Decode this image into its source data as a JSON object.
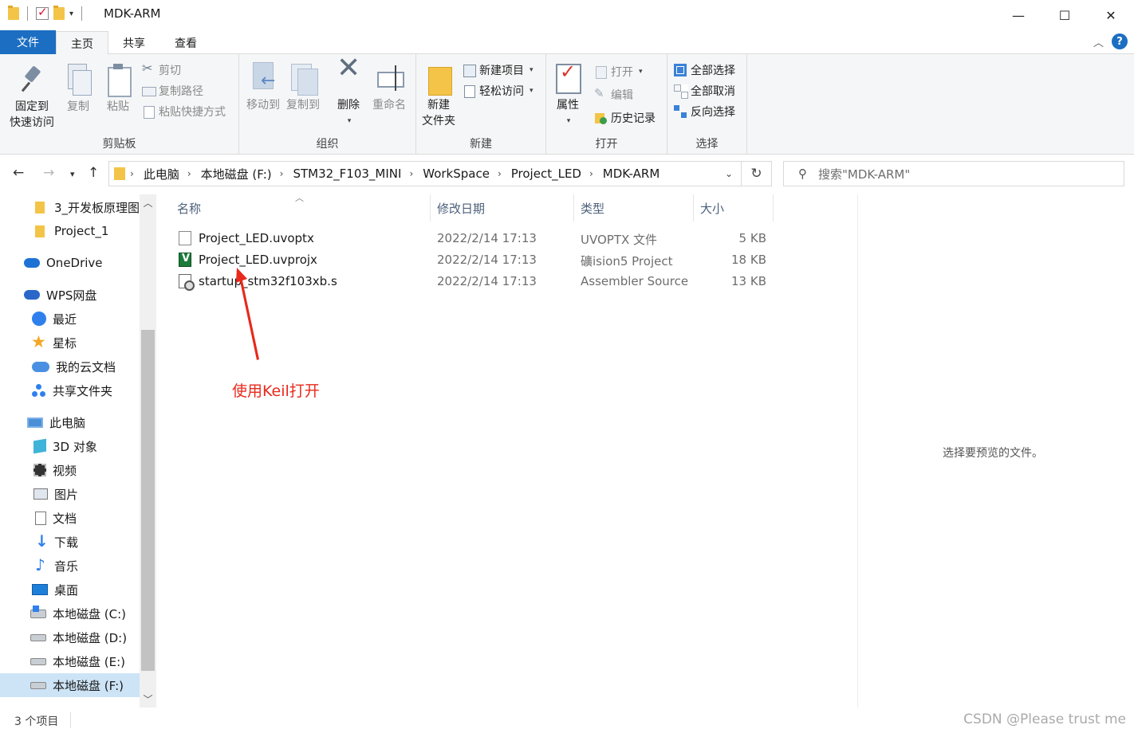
{
  "window": {
    "title": "MDK-ARM",
    "minimize": "—",
    "maximize": "☐",
    "close": "✕"
  },
  "ribbon_tabs": {
    "file": "文件",
    "home": "主页",
    "share": "共享",
    "view": "查看"
  },
  "ribbon": {
    "clipboard": {
      "label": "剪贴板",
      "pin": "固定到\n快速访问",
      "pin_line1": "固定到",
      "pin_line2": "快速访问",
      "copy": "复制",
      "paste": "粘贴",
      "cut": "剪切",
      "copy_path": "复制路径",
      "paste_shortcut": "粘贴快捷方式"
    },
    "organize": {
      "label": "组织",
      "move_to": "移动到",
      "copy_to": "复制到",
      "delete": "删除",
      "rename": "重命名"
    },
    "new": {
      "label": "新建",
      "new_folder_line1": "新建",
      "new_folder_line2": "文件夹",
      "new_item": "新建项目",
      "easy_access": "轻松访问"
    },
    "open": {
      "label": "打开",
      "properties": "属性",
      "open": "打开",
      "edit": "编辑",
      "history": "历史记录"
    },
    "select": {
      "label": "选择",
      "select_all": "全部选择",
      "select_none": "全部取消",
      "invert": "反向选择"
    }
  },
  "address": {
    "crumbs": [
      "此电脑",
      "本地磁盘 (F:)",
      "STM32_F103_MINI",
      "WorkSpace",
      "Project_LED",
      "MDK-ARM"
    ]
  },
  "search": {
    "placeholder": "搜索\"MDK-ARM\""
  },
  "nav_pane": {
    "items": [
      {
        "label": "3_开发板原理图",
        "icon": "folder-icon"
      },
      {
        "label": "Project_1",
        "icon": "folder-icon"
      },
      {
        "label": "OneDrive",
        "icon": "onedrive-icon"
      },
      {
        "label": "WPS网盘",
        "icon": "wps-cloud-icon"
      },
      {
        "label": "最近",
        "icon": "recent-icon"
      },
      {
        "label": "星标",
        "icon": "star-icon"
      },
      {
        "label": "我的云文档",
        "icon": "cloud-docs-icon"
      },
      {
        "label": "共享文件夹",
        "icon": "shared-folder-icon"
      },
      {
        "label": "此电脑",
        "icon": "this-pc-icon"
      },
      {
        "label": "3D 对象",
        "icon": "3d-objects-icon"
      },
      {
        "label": "视频",
        "icon": "video-icon"
      },
      {
        "label": "图片",
        "icon": "pictures-icon"
      },
      {
        "label": "文档",
        "icon": "documents-icon"
      },
      {
        "label": "下载",
        "icon": "download-icon"
      },
      {
        "label": "音乐",
        "icon": "music-icon"
      },
      {
        "label": "桌面",
        "icon": "desktop-icon"
      },
      {
        "label": "本地磁盘 (C:)",
        "icon": "drive-c-icon"
      },
      {
        "label": "本地磁盘 (D:)",
        "icon": "drive-icon"
      },
      {
        "label": "本地磁盘 (E:)",
        "icon": "drive-icon"
      },
      {
        "label": "本地磁盘 (F:)",
        "icon": "drive-icon",
        "selected": true
      }
    ]
  },
  "file_list": {
    "columns": {
      "name": "名称",
      "date": "修改日期",
      "type": "类型",
      "size": "大小"
    },
    "rows": [
      {
        "name": "Project_LED.uvoptx",
        "date": "2022/2/14 17:13",
        "type": "UVOPTX 文件",
        "size": "5 KB",
        "icon": "blank-file-icon"
      },
      {
        "name": "Project_LED.uvprojx",
        "date": "2022/2/14 17:13",
        "type": "礦ision5 Project",
        "size": "18 KB",
        "icon": "keil-project-icon"
      },
      {
        "name": "startup_stm32f103xb.s",
        "date": "2022/2/14 17:13",
        "type": "Assembler Source",
        "size": "13 KB",
        "icon": "assembler-file-icon"
      }
    ]
  },
  "annotation": {
    "text": "使用Keil打开",
    "color": "#e8291c"
  },
  "preview": {
    "message": "选择要预览的文件。"
  },
  "status": {
    "count": "3 个项目"
  },
  "watermark": "CSDN @Please trust me",
  "colors": {
    "accent": "#1b6ec2",
    "selection": "#cde4f7"
  }
}
